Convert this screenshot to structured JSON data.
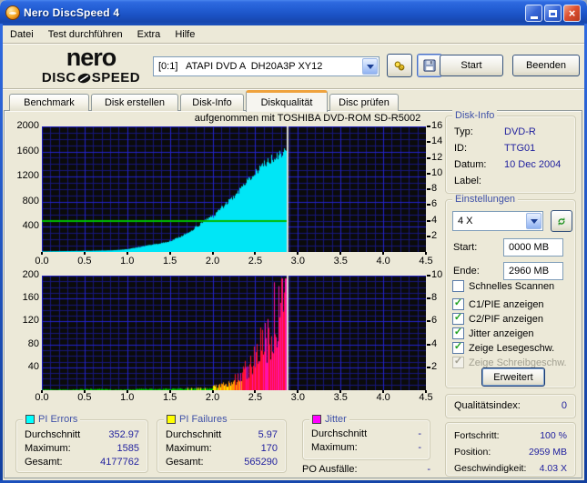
{
  "window": {
    "title": "Nero DiscSpeed 4"
  },
  "menu": {
    "items": [
      "Datei",
      "Test durchführen",
      "Extra",
      "Hilfe"
    ]
  },
  "toolbar": {
    "logo_top": "nero",
    "logo_bottom_left": "DISC",
    "logo_bottom_right": "SPEED",
    "drive": "[0:1]   ATAPI DVD A  DH20A3P XY12",
    "start_label": "Start",
    "quit_label": "Beenden"
  },
  "tabs": {
    "items": [
      "Benchmark",
      "Disk erstellen",
      "Disk-Info",
      "Diskqualität",
      "Disc prüfen"
    ],
    "active": "Diskqualität"
  },
  "disk_info": {
    "title": "Disk-Info",
    "rows": [
      {
        "label": "Typ:",
        "value": "DVD-R"
      },
      {
        "label": "ID:",
        "value": "TTG01"
      },
      {
        "label": "Datum:",
        "value": "10 Dec 2004"
      },
      {
        "label": "Label:",
        "value": ""
      }
    ]
  },
  "settings": {
    "title": "Einstellungen",
    "speed": "4 X",
    "start_label": "Start:",
    "start_value": "0000 MB",
    "end_label": "Ende:",
    "end_value": "2960 MB",
    "checkboxes": [
      {
        "label": "Schnelles Scannen",
        "checked": false,
        "enabled": true
      },
      {
        "label": "C1/PIE anzeigen",
        "checked": true,
        "enabled": true
      },
      {
        "label": "C2/PIF anzeigen",
        "checked": true,
        "enabled": true
      },
      {
        "label": "Jitter anzeigen",
        "checked": true,
        "enabled": true
      },
      {
        "label": "Zeige Lesegeschw.",
        "checked": true,
        "enabled": true
      },
      {
        "label": "Zeige Schreibgeschw.",
        "checked": true,
        "enabled": false
      }
    ],
    "advanced_label": "Erweitert"
  },
  "quality": {
    "label": "Qualitätsindex:",
    "value": "0"
  },
  "progress": {
    "rows": [
      {
        "label": "Fortschritt:",
        "value": "100 %"
      },
      {
        "label": "Position:",
        "value": "2959 MB"
      },
      {
        "label": "Geschwindigkeit:",
        "value": "4.03 X"
      }
    ]
  },
  "stats": [
    {
      "title": "PI Errors",
      "swatch": "swatch_pi_errors",
      "rows": [
        {
          "label": "Durchschnitt",
          "value": "352.97"
        },
        {
          "label": "Maximum:",
          "value": "1585"
        },
        {
          "label": "Gesamt:",
          "value": "4177762"
        }
      ]
    },
    {
      "title": "PI Failures",
      "swatch": "swatch_pi_failures",
      "rows": [
        {
          "label": "Durchschnitt",
          "value": "5.97"
        },
        {
          "label": "Maximum:",
          "value": "170"
        },
        {
          "label": "Gesamt:",
          "value": "565290"
        }
      ]
    },
    {
      "title": "Jitter",
      "swatch": "swatch_jitter",
      "rows": [
        {
          "label": "Durchschnitt",
          "value": "-"
        },
        {
          "label": "Maximum:",
          "value": "-"
        }
      ]
    }
  ],
  "po_row": {
    "label": "PO Ausfälle:",
    "value": "-"
  },
  "chart_data": [
    {
      "type": "area",
      "name": "PI Errors scan",
      "title": "aufgenommen mit TOSHIBA DVD-ROM SD-R5002",
      "xlim": [
        0,
        4.5
      ],
      "ylim_left": [
        0,
        2000
      ],
      "ylim_right": [
        0,
        16
      ],
      "x_ticks": [
        "0.0",
        "0.5",
        "1.0",
        "1.5",
        "2.0",
        "2.5",
        "3.0",
        "3.5",
        "4.0",
        "4.5"
      ],
      "y_ticks_left": [
        400,
        800,
        1200,
        1600,
        2000
      ],
      "y_ticks_right": [
        2,
        4,
        6,
        8,
        10,
        12,
        14,
        16
      ],
      "x_minor_step": 0.1,
      "x_major_step": 0.5,
      "y_minor_step": 100,
      "y_major_step": 400,
      "scan_end_x": 2.87,
      "read_speed_line_right_value": 4,
      "points": [
        [
          0,
          10
        ],
        [
          0.2,
          13
        ],
        [
          0.4,
          16
        ],
        [
          0.6,
          20
        ],
        [
          0.8,
          26
        ],
        [
          0.9,
          32
        ],
        [
          1.0,
          45
        ],
        [
          1.1,
          70
        ],
        [
          1.2,
          95
        ],
        [
          1.3,
          120
        ],
        [
          1.4,
          140
        ],
        [
          1.5,
          175
        ],
        [
          1.6,
          230
        ],
        [
          1.7,
          300
        ],
        [
          1.8,
          395
        ],
        [
          1.9,
          490
        ],
        [
          1.95,
          540
        ],
        [
          2.0,
          560
        ],
        [
          2.05,
          640
        ],
        [
          2.1,
          720
        ],
        [
          2.15,
          760
        ],
        [
          2.2,
          860
        ],
        [
          2.25,
          890
        ],
        [
          2.3,
          950
        ],
        [
          2.33,
          1070
        ],
        [
          2.36,
          1040
        ],
        [
          2.4,
          1120
        ],
        [
          2.45,
          1190
        ],
        [
          2.5,
          1260
        ],
        [
          2.55,
          1330
        ],
        [
          2.6,
          1400
        ],
        [
          2.65,
          1455
        ],
        [
          2.7,
          1500
        ],
        [
          2.75,
          1525
        ],
        [
          2.8,
          1550
        ],
        [
          2.84,
          1575
        ],
        [
          2.87,
          1555
        ]
      ]
    },
    {
      "type": "bar",
      "name": "PI Failures scan",
      "xlim": [
        0,
        4.5
      ],
      "ylim_left": [
        0,
        200
      ],
      "ylim_right": [
        0,
        10
      ],
      "x_ticks": [
        "0.0",
        "0.5",
        "1.0",
        "1.5",
        "2.0",
        "2.5",
        "3.0",
        "3.5",
        "4.0",
        "4.5"
      ],
      "y_ticks_left": [
        40,
        80,
        120,
        160,
        200
      ],
      "y_ticks_right": [
        2,
        4,
        6,
        8,
        10
      ],
      "x_minor_step": 0.1,
      "x_major_step": 0.5,
      "y_minor_step": 10,
      "y_major_step": 40,
      "scan_end_x": 2.87,
      "points": [
        [
          0,
          1
        ],
        [
          0.3,
          1
        ],
        [
          0.6,
          2
        ],
        [
          0.9,
          1
        ],
        [
          1.2,
          2
        ],
        [
          1.5,
          2
        ],
        [
          1.7,
          3
        ],
        [
          1.85,
          3
        ],
        [
          1.95,
          4
        ],
        [
          2.0,
          5
        ],
        [
          2.05,
          7
        ],
        [
          2.1,
          8
        ],
        [
          2.15,
          10
        ],
        [
          2.2,
          14
        ],
        [
          2.25,
          18
        ],
        [
          2.3,
          24
        ],
        [
          2.35,
          30
        ],
        [
          2.4,
          38
        ],
        [
          2.45,
          46
        ],
        [
          2.5,
          56
        ],
        [
          2.55,
          68
        ],
        [
          2.6,
          85
        ],
        [
          2.65,
          100
        ],
        [
          2.7,
          115
        ],
        [
          2.75,
          133
        ],
        [
          2.8,
          150
        ],
        [
          2.83,
          160
        ],
        [
          2.86,
          170
        ],
        [
          2.87,
          160
        ]
      ]
    }
  ],
  "colors": {
    "chart_bg": "#0b0b0b",
    "grid_major": "#2323cf",
    "grid_minor": "#17177d",
    "pi_errors": "#00e6f6",
    "read_speed": "#00bc00",
    "cursor": "#dcdcdc",
    "pif_low": "#00c800",
    "pif_mid": "#ffee00",
    "pif_high": "#ff9800",
    "pif_severe_a": "#ff1133",
    "pif_severe_b": "#ff10aa",
    "swatch_pi_errors": "#00ffff",
    "swatch_pi_failures": "#ffff00",
    "swatch_jitter": "#ff00ff",
    "value_text": "#1f1f9e",
    "caption_text": "#3f51a8",
    "tab_accent": "#efa23d"
  }
}
